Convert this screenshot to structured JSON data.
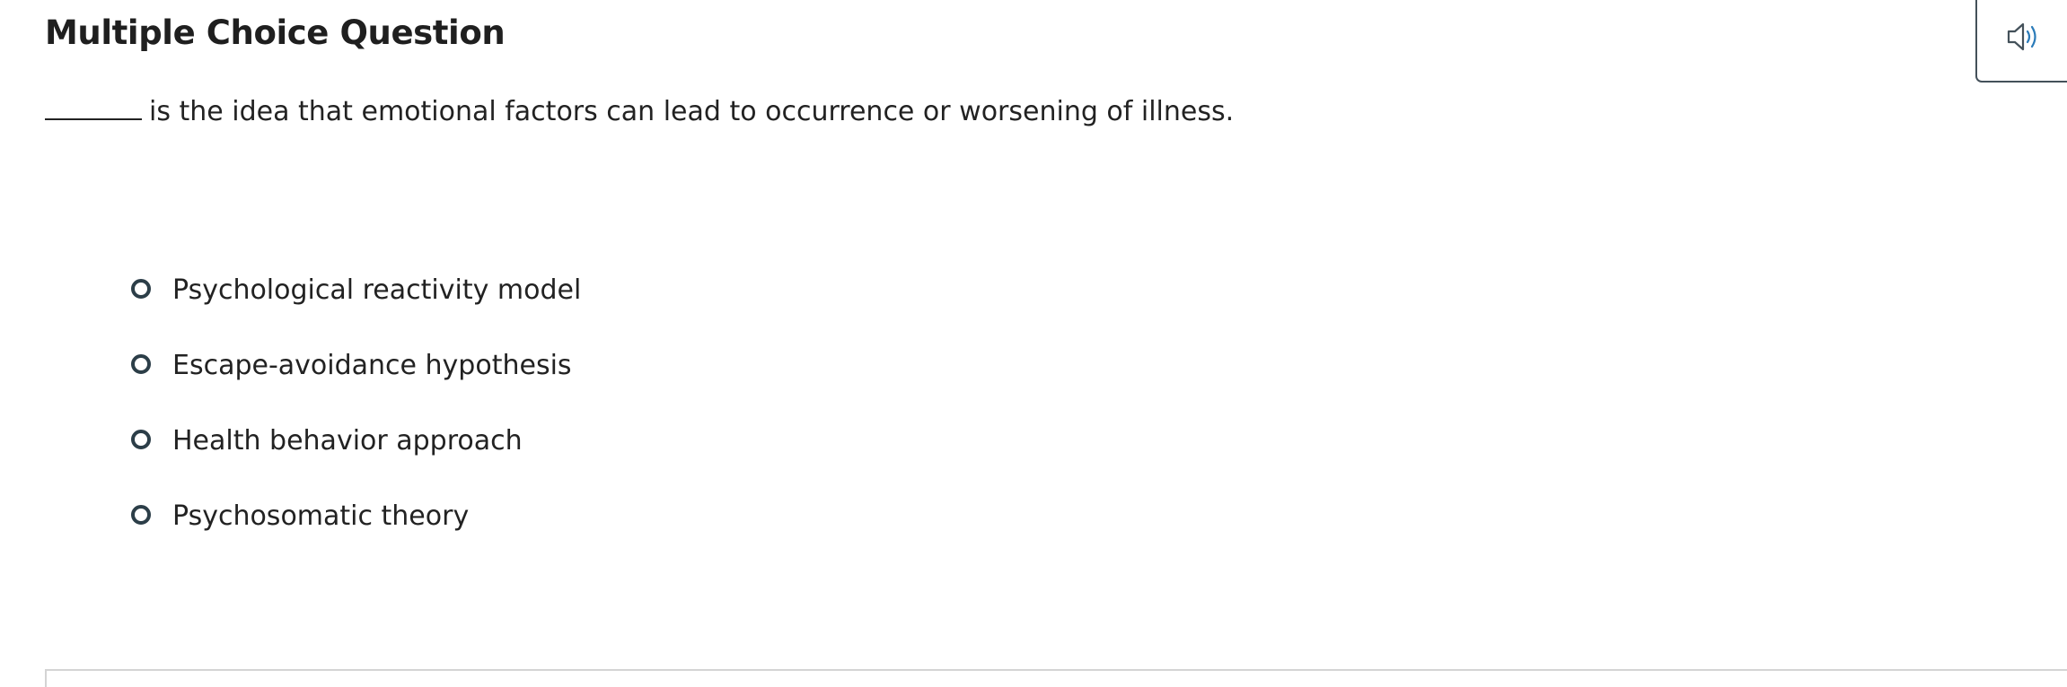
{
  "question": {
    "title": "Multiple Choice Question",
    "prompt": "is the idea that emotional factors can lead to occurrence or worsening of illness.",
    "choices": [
      {
        "label": "Psychological reactivity model"
      },
      {
        "label": "Escape-avoidance hypothesis"
      },
      {
        "label": "Health behavior approach"
      },
      {
        "label": "Psychosomatic theory"
      }
    ]
  },
  "toolbar": {
    "audio_icon": "speaker-icon"
  },
  "colors": {
    "text": "#222222",
    "radio_border": "#2c3e48",
    "icon_accent": "#2b7bb9",
    "divider": "#d4d4d4"
  }
}
